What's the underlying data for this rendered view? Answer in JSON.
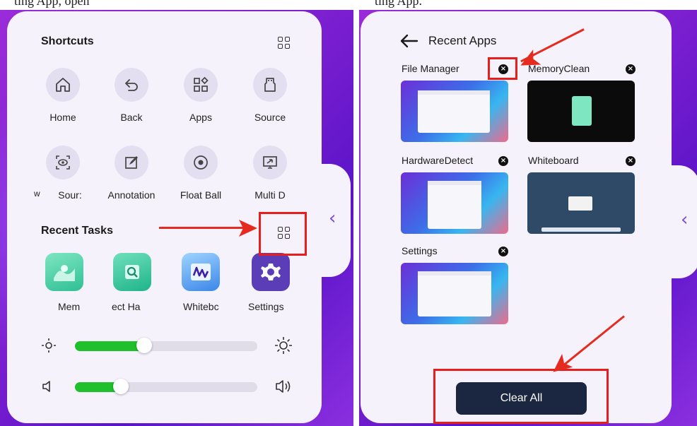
{
  "caption": {
    "left": "ting App, open",
    "right": "ting App."
  },
  "left": {
    "shortcuts_title": "Shortcuts",
    "shortcuts": [
      {
        "label": "Home",
        "icon": "home-icon"
      },
      {
        "label": "Back",
        "icon": "back-icon"
      },
      {
        "label": "Apps",
        "icon": "apps-icon"
      },
      {
        "label": "Source",
        "icon": "source-icon"
      },
      {
        "label": "Sour:",
        "icon": "eye-icon"
      },
      {
        "label": "Annotation",
        "icon": "annotation-icon"
      },
      {
        "label": "Float Ball",
        "icon": "float-ball-icon"
      },
      {
        "label": "Multi D",
        "icon": "multi-display-icon"
      }
    ],
    "shortcut_cut_prefix": "w",
    "recent_tasks_title": "Recent Tasks",
    "recent_tasks": [
      {
        "label": "Mem",
        "icon": "memory-clean-icon",
        "color": "#4fd2a8"
      },
      {
        "label": "ect  Ha",
        "icon": "hardware-detect-icon",
        "color": "#3cc8a0"
      },
      {
        "label": "Whitebc",
        "icon": "whiteboard-icon",
        "color": "#5aa8f0"
      },
      {
        "label": "Settings",
        "icon": "gear-icon",
        "color": "#5b3db8"
      }
    ],
    "brightness_level": 0.38,
    "volume_level": 0.25
  },
  "right": {
    "title": "Recent Apps",
    "apps": [
      {
        "name": "File Manager"
      },
      {
        "name": "MemoryClean"
      },
      {
        "name": "HardwareDetect"
      },
      {
        "name": "Whiteboard"
      },
      {
        "name": "Settings"
      }
    ],
    "close_glyph": "×",
    "clear_all": "Clear All"
  },
  "colors": {
    "accent": "#7a4cd9",
    "slider_fill": "#1fc02b",
    "annotation_red": "#e61e1e",
    "clear_button": "#1b2640"
  }
}
